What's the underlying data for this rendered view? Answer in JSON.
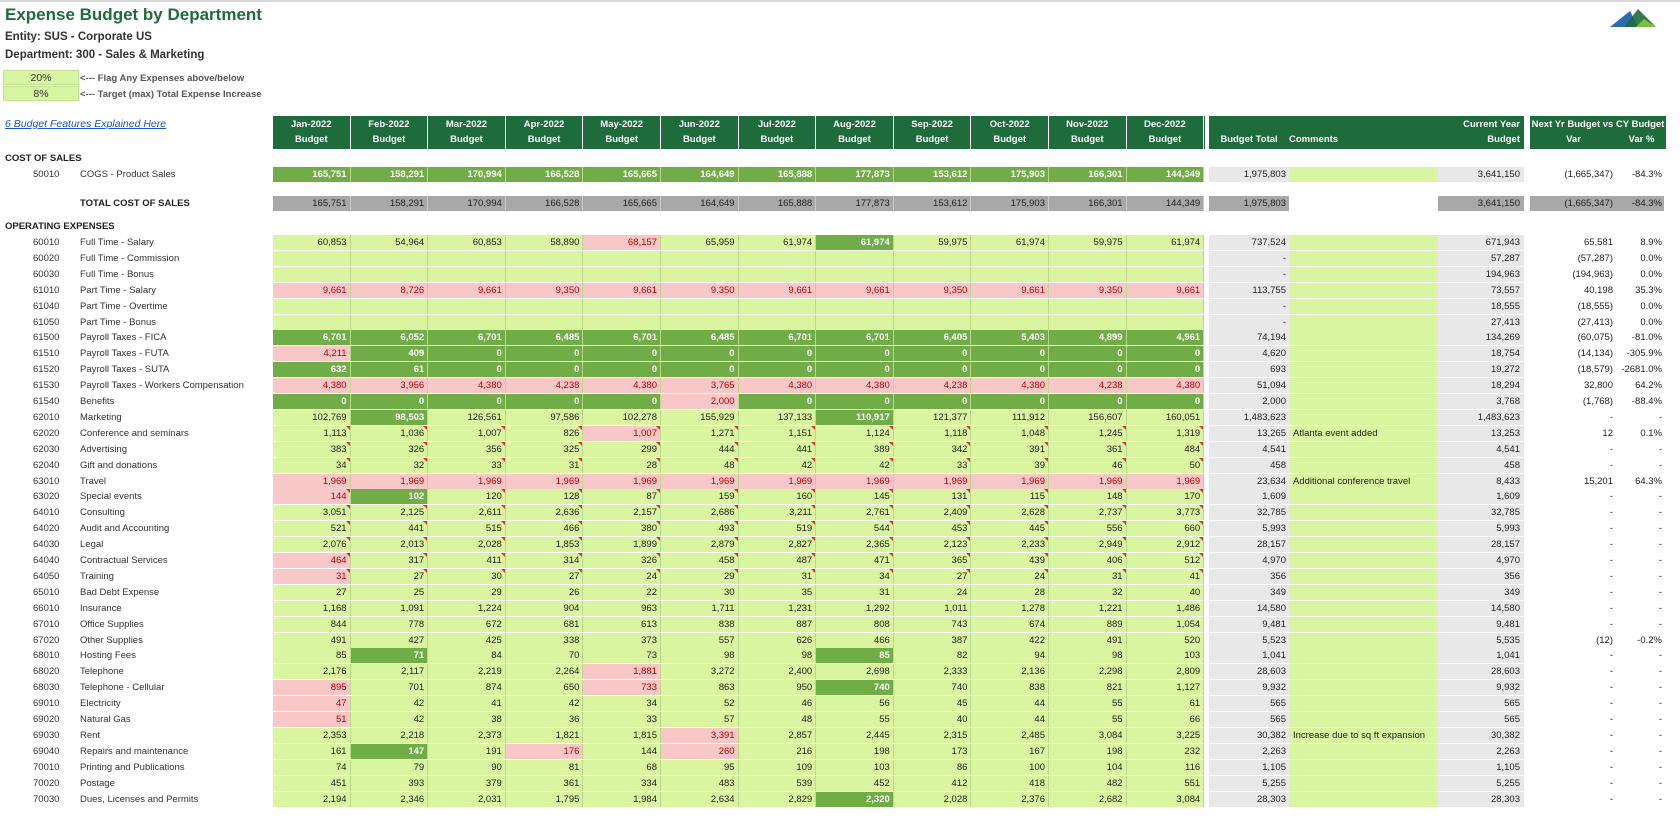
{
  "title": "Expense Budget by Department",
  "entity": "Entity: SUS - Corporate US",
  "department": "Department:  300 - Sales & Marketing",
  "flag_pct": "20%",
  "flag_note": "<--- Flag Any Expenses above/below",
  "target_pct": "8%",
  "target_note": "<--- Target (max) Total Expense Increase",
  "features_link": "6 Budget Features Explained Here",
  "colors": {
    "header_green": "#1e6b3c",
    "input_green": "#d9f5a0",
    "dark_green": "#70ad47",
    "flag_pink": "#f8c8c8",
    "subtotal_gray": "#a8a8a8"
  },
  "months": [
    "Jan-2022",
    "Feb-2022",
    "Mar-2022",
    "Apr-2022",
    "May-2022",
    "Jun-2022",
    "Jul-2022",
    "Aug-2022",
    "Sep-2022",
    "Oct-2022",
    "Nov-2022",
    "Dec-2022"
  ],
  "budget_word": "Budget",
  "hdr_budget_total": "Budget Total",
  "hdr_comments": "Comments",
  "hdr_current_year": "Current Year",
  "hdr_current_budget": "Budget",
  "hdr_next_yr": "Next Yr Budget vs CY Budget",
  "hdr_var": "Var",
  "hdr_var_pct": "Var %",
  "sec_cos": "COST OF SALES",
  "total_cos_label": "TOTAL COST OF SALES",
  "sec_opex": "OPERATING EXPENSES",
  "cos_row": {
    "acct": "50010",
    "name": "COGS - Product Sales",
    "vals": [
      "165,751",
      "158,291",
      "170,994",
      "166,528",
      "165,665",
      "164,649",
      "165,888",
      "177,873",
      "153,612",
      "175,903",
      "166,301",
      "144,349"
    ],
    "total": "1,975,803",
    "comment": "",
    "cy": "3,641,150",
    "var": "(1,665,347)",
    "vp": "-84.3%"
  },
  "total_cos": {
    "vals": [
      "165,751",
      "158,291",
      "170,994",
      "166,528",
      "165,665",
      "164,649",
      "165,888",
      "177,873",
      "153,612",
      "175,903",
      "166,301",
      "144,349"
    ],
    "total": "1,975,803",
    "cy": "3,641,150",
    "var": "(1,665,347)",
    "vp": "-84.3%"
  },
  "rows": [
    {
      "acct": "60010",
      "name": "Full Time - Salary",
      "vals": [
        "60,853",
        "54,964",
        "60,853",
        "58,890",
        "68,157",
        "65,959",
        "61,974",
        "61,974",
        "59,975",
        "61,974",
        "59,975",
        "61,974"
      ],
      "st": "ggggpggdgggg",
      "fl": "",
      "total": "737,524",
      "comment": "",
      "cy": "671,943",
      "var": "65,581",
      "vp": "8.9%"
    },
    {
      "acct": "60020",
      "name": "Full Time - Commission",
      "vals": [
        "",
        "",
        "",
        "",
        "",
        "",
        "",
        "",
        "",
        "",
        "",
        ""
      ],
      "st": "gggggggggggg",
      "fl": "",
      "total": "-",
      "comment": "",
      "cy": "57,287",
      "var": "(57,287)",
      "vp": "0.0%"
    },
    {
      "acct": "60030",
      "name": "Full Time - Bonus",
      "vals": [
        "",
        "",
        "",
        "",
        "",
        "",
        "",
        "",
        "",
        "",
        "",
        ""
      ],
      "st": "gggggggggggg",
      "fl": "",
      "total": "-",
      "comment": "",
      "cy": "194,963",
      "var": "(194,963)",
      "vp": "0.0%"
    },
    {
      "acct": "61010",
      "name": "Part Time - Salary",
      "vals": [
        "9,661",
        "8,726",
        "9,661",
        "9,350",
        "9,661",
        "9,350",
        "9,661",
        "9,661",
        "9,350",
        "9,661",
        "9,350",
        "9,661"
      ],
      "st": "pppppppppppp",
      "fl": "",
      "total": "113,755",
      "comment": "",
      "cy": "73,557",
      "var": "40,198",
      "vp": "35.3%"
    },
    {
      "acct": "61040",
      "name": "Part Time - Overtime",
      "vals": [
        "",
        "",
        "",
        "",
        "",
        "",
        "",
        "",
        "",
        "",
        "",
        ""
      ],
      "st": "gggggggggggg",
      "fl": "",
      "total": "-",
      "comment": "",
      "cy": "18,555",
      "var": "(18,555)",
      "vp": "0.0%"
    },
    {
      "acct": "61050",
      "name": "Part Time - Bonus",
      "vals": [
        "",
        "",
        "",
        "",
        "",
        "",
        "",
        "",
        "",
        "",
        "",
        ""
      ],
      "st": "gggggggggggg",
      "fl": "",
      "total": "-",
      "comment": "",
      "cy": "27,413",
      "var": "(27,413)",
      "vp": "0.0%"
    },
    {
      "acct": "61500",
      "name": "Payroll Taxes - FICA",
      "vals": [
        "6,701",
        "6,052",
        "6,701",
        "6,485",
        "6,701",
        "6,485",
        "6,701",
        "6,701",
        "6,405",
        "5,403",
        "4,899",
        "4,961"
      ],
      "st": "dddddddddddd",
      "fl": "",
      "total": "74,194",
      "comment": "",
      "cy": "134,269",
      "var": "(60,075)",
      "vp": "-81.0%"
    },
    {
      "acct": "61510",
      "name": "Payroll Taxes - FUTA",
      "vals": [
        "4,211",
        "409",
        "0",
        "0",
        "0",
        "0",
        "0",
        "0",
        "0",
        "0",
        "0",
        "0"
      ],
      "st": "pddddddddddd",
      "fl": "",
      "total": "4,620",
      "comment": "",
      "cy": "18,754",
      "var": "(14,134)",
      "vp": "-305.9%"
    },
    {
      "acct": "61520",
      "name": "Payroll Taxes - SUTA",
      "vals": [
        "632",
        "61",
        "0",
        "0",
        "0",
        "0",
        "0",
        "0",
        "0",
        "0",
        "0",
        "0"
      ],
      "st": "dddddddddddd",
      "fl": "",
      "total": "693",
      "comment": "",
      "cy": "19,272",
      "var": "(18,579)",
      "vp": "-2681.0%"
    },
    {
      "acct": "61530",
      "name": "Payroll Taxes - Workers Compensation",
      "vals": [
        "4,380",
        "3,956",
        "4,380",
        "4,238",
        "4,380",
        "3,765",
        "4,380",
        "4,380",
        "4,238",
        "4,380",
        "4,238",
        "4,380"
      ],
      "st": "pppppppppppp",
      "fl": "",
      "total": "51,094",
      "comment": "",
      "cy": "18,294",
      "var": "32,800",
      "vp": "64.2%"
    },
    {
      "acct": "61540",
      "name": "Benefits",
      "vals": [
        "0",
        "0",
        "0",
        "0",
        "0",
        "2,000",
        "0",
        "0",
        "0",
        "0",
        "0",
        "0"
      ],
      "st": "dddddpdddddd",
      "fl": "",
      "total": "2,000",
      "comment": "",
      "cy": "3,768",
      "var": "(1,768)",
      "vp": "-88.4%"
    },
    {
      "acct": "62010",
      "name": "Marketing",
      "vals": [
        "102,769",
        "98,503",
        "126,561",
        "97,586",
        "102,278",
        "155,929",
        "137,133",
        "110,917",
        "121,377",
        "111,912",
        "156,607",
        "160,051"
      ],
      "st": "gdgggggdgggg",
      "fl": "",
      "total": "1,483,623",
      "comment": "",
      "cy": "1,483,623",
      "var": "-",
      "vp": "-"
    },
    {
      "acct": "62020",
      "name": "Conference and seminars",
      "vals": [
        "1,113",
        "1,036",
        "1,007",
        "826",
        "1,007",
        "1,271",
        "1,151",
        "1,124",
        "1,118",
        "1,048",
        "1,245",
        "1,319"
      ],
      "st": "ggggpggggggg",
      "fl": "111111111111",
      "total": "13,265",
      "comment": "Atlanta event added",
      "cy": "13,253",
      "var": "12",
      "vp": "0.1%"
    },
    {
      "acct": "62030",
      "name": "Advertising",
      "vals": [
        "383",
        "326",
        "356",
        "325",
        "299",
        "444",
        "441",
        "389",
        "342",
        "391",
        "361",
        "484"
      ],
      "st": "gggggggggggg",
      "fl": "111111111111",
      "total": "4,541",
      "comment": "",
      "cy": "4,541",
      "var": "-",
      "vp": "-"
    },
    {
      "acct": "62040",
      "name": "Gift and donations",
      "vals": [
        "34",
        "32",
        "33",
        "31",
        "28",
        "48",
        "42",
        "42",
        "33",
        "39",
        "46",
        "50"
      ],
      "st": "gggggggggggg",
      "fl": "111111111111",
      "total": "458",
      "comment": "",
      "cy": "458",
      "var": "-",
      "vp": "-"
    },
    {
      "acct": "63010",
      "name": "Travel",
      "vals": [
        "1,969",
        "1,969",
        "1,969",
        "1,969",
        "1,969",
        "1,969",
        "1,969",
        "1,969",
        "1,969",
        "1,969",
        "1,969",
        "1,969"
      ],
      "st": "pppppppppppp",
      "fl": "",
      "total": "23,634",
      "comment": "Additional conference travel",
      "cy": "8,433",
      "var": "15,201",
      "vp": "64.3%"
    },
    {
      "acct": "63020",
      "name": "Special events",
      "vals": [
        "144",
        "102",
        "120",
        "128",
        "87",
        "159",
        "160",
        "145",
        "131",
        "115",
        "148",
        "170"
      ],
      "st": "pdgggggggggg",
      "fl": "101111111111",
      "total": "1,609",
      "comment": "",
      "cy": "1,609",
      "var": "-",
      "vp": "-"
    },
    {
      "acct": "64010",
      "name": "Consulting",
      "vals": [
        "3,051",
        "2,125",
        "2,611",
        "2,636",
        "2,157",
        "2,686",
        "3,211",
        "2,761",
        "2,409",
        "2,628",
        "2,737",
        "3,773"
      ],
      "st": "gggggggggggg",
      "fl": "111111111111",
      "total": "32,785",
      "comment": "",
      "cy": "32,785",
      "var": "-",
      "vp": "-"
    },
    {
      "acct": "64020",
      "name": "Audit and Accounting",
      "vals": [
        "521",
        "441",
        "515",
        "466",
        "380",
        "493",
        "519",
        "544",
        "453",
        "445",
        "556",
        "660"
      ],
      "st": "gggggggggggg",
      "fl": "111111111111",
      "total": "5,993",
      "comment": "",
      "cy": "5,993",
      "var": "-",
      "vp": "-"
    },
    {
      "acct": "64030",
      "name": "Legal",
      "vals": [
        "2,076",
        "2,013",
        "2,028",
        "1,853",
        "1,899",
        "2,879",
        "2,827",
        "2,365",
        "2,123",
        "2,233",
        "2,949",
        "2,912"
      ],
      "st": "gggggggggggg",
      "fl": "111111111111",
      "total": "28,157",
      "comment": "",
      "cy": "28,157",
      "var": "-",
      "vp": "-"
    },
    {
      "acct": "64040",
      "name": "Contractual Services",
      "vals": [
        "464",
        "317",
        "411",
        "314",
        "326",
        "458",
        "487",
        "471",
        "365",
        "439",
        "406",
        "512"
      ],
      "st": "pggggggggggg",
      "fl": "111111111111",
      "total": "4,970",
      "comment": "",
      "cy": "4,970",
      "var": "-",
      "vp": "-"
    },
    {
      "acct": "64050",
      "name": "Training",
      "vals": [
        "31",
        "27",
        "30",
        "27",
        "24",
        "29",
        "31",
        "34",
        "27",
        "24",
        "31",
        "41"
      ],
      "st": "pggggggggggg",
      "fl": "111111111111",
      "total": "356",
      "comment": "",
      "cy": "356",
      "var": "-",
      "vp": "-"
    },
    {
      "acct": "65010",
      "name": "Bad Debt Expense",
      "vals": [
        "27",
        "25",
        "29",
        "26",
        "22",
        "30",
        "35",
        "31",
        "24",
        "28",
        "32",
        "40"
      ],
      "st": "gggggggggggg",
      "fl": "",
      "total": "349",
      "comment": "",
      "cy": "349",
      "var": "-",
      "vp": "-"
    },
    {
      "acct": "66010",
      "name": "Insurance",
      "vals": [
        "1,168",
        "1,091",
        "1,224",
        "904",
        "963",
        "1,711",
        "1,231",
        "1,292",
        "1,011",
        "1,278",
        "1,221",
        "1,486"
      ],
      "st": "gggggggggggg",
      "fl": "",
      "total": "14,580",
      "comment": "",
      "cy": "14,580",
      "var": "-",
      "vp": "-"
    },
    {
      "acct": "67010",
      "name": "Office Supplies",
      "vals": [
        "844",
        "778",
        "672",
        "681",
        "613",
        "838",
        "887",
        "808",
        "743",
        "674",
        "889",
        "1,054"
      ],
      "st": "gggggggggggg",
      "fl": "",
      "total": "9,481",
      "comment": "",
      "cy": "9,481",
      "var": "-",
      "vp": "-"
    },
    {
      "acct": "67020",
      "name": "Other Supplies",
      "vals": [
        "491",
        "427",
        "425",
        "338",
        "373",
        "557",
        "626",
        "466",
        "387",
        "422",
        "491",
        "520"
      ],
      "st": "gggggggggggg",
      "fl": "",
      "total": "5,523",
      "comment": "",
      "cy": "5,535",
      "var": "(12)",
      "vp": "-0.2%"
    },
    {
      "acct": "68010",
      "name": "Hosting Fees",
      "vals": [
        "85",
        "71",
        "84",
        "70",
        "73",
        "98",
        "98",
        "85",
        "82",
        "94",
        "98",
        "103"
      ],
      "st": "gdgggggdgggg",
      "fl": "",
      "total": "1,041",
      "comment": "",
      "cy": "1,041",
      "var": "-",
      "vp": "-"
    },
    {
      "acct": "68020",
      "name": "Telephone",
      "vals": [
        "2,176",
        "2,117",
        "2,219",
        "2,264",
        "1,881",
        "3,272",
        "2,400",
        "2,698",
        "2,333",
        "2,136",
        "2,298",
        "2,809"
      ],
      "st": "ggggpggggggg",
      "fl": "",
      "total": "28,603",
      "comment": "",
      "cy": "28,603",
      "var": "-",
      "vp": "-"
    },
    {
      "acct": "68030",
      "name": "Telephone - Cellular",
      "vals": [
        "895",
        "701",
        "874",
        "650",
        "733",
        "863",
        "950",
        "740",
        "740",
        "838",
        "821",
        "1,127"
      ],
      "st": "pgggpggdgggg",
      "fl": "",
      "total": "9,932",
      "comment": "",
      "cy": "9,932",
      "var": "-",
      "vp": "-"
    },
    {
      "acct": "69010",
      "name": "Electricity",
      "vals": [
        "47",
        "42",
        "41",
        "42",
        "34",
        "52",
        "46",
        "56",
        "45",
        "44",
        "55",
        "61"
      ],
      "st": "pggggggggggg",
      "fl": "",
      "total": "565",
      "comment": "",
      "cy": "565",
      "var": "-",
      "vp": "-"
    },
    {
      "acct": "69020",
      "name": "Natural Gas",
      "vals": [
        "51",
        "42",
        "38",
        "36",
        "33",
        "57",
        "48",
        "55",
        "40",
        "44",
        "55",
        "66"
      ],
      "st": "pggggggggggg",
      "fl": "",
      "total": "565",
      "comment": "",
      "cy": "565",
      "var": "-",
      "vp": "-"
    },
    {
      "acct": "69030",
      "name": "Rent",
      "vals": [
        "2,353",
        "2,218",
        "2,373",
        "1,821",
        "1,815",
        "3,391",
        "2,857",
        "2,445",
        "2,315",
        "2,485",
        "3,084",
        "3,225"
      ],
      "st": "gggggpgggggg",
      "fl": "",
      "total": "30,382",
      "comment": "Increase due to sq ft expansion",
      "cy": "30,382",
      "var": "-",
      "vp": "-"
    },
    {
      "acct": "69040",
      "name": "Repairs and maintenance",
      "vals": [
        "161",
        "147",
        "191",
        "176",
        "144",
        "260",
        "216",
        "198",
        "173",
        "167",
        "198",
        "232"
      ],
      "st": "gdgpgpgggggg",
      "fl": "",
      "total": "2,263",
      "comment": "",
      "cy": "2,263",
      "var": "-",
      "vp": "-"
    },
    {
      "acct": "70010",
      "name": "Printing and Publications",
      "vals": [
        "74",
        "79",
        "90",
        "81",
        "68",
        "95",
        "109",
        "103",
        "86",
        "100",
        "104",
        "116"
      ],
      "st": "gggggggggggg",
      "fl": "",
      "total": "1,105",
      "comment": "",
      "cy": "1,105",
      "var": "-",
      "vp": "-"
    },
    {
      "acct": "70020",
      "name": "Postage",
      "vals": [
        "451",
        "393",
        "379",
        "361",
        "334",
        "483",
        "539",
        "452",
        "412",
        "418",
        "482",
        "551"
      ],
      "st": "gggggggggggg",
      "fl": "",
      "total": "5,255",
      "comment": "",
      "cy": "5,255",
      "var": "-",
      "vp": "-"
    },
    {
      "acct": "70030",
      "name": "Dues, Licenses and Permits",
      "vals": [
        "2,194",
        "2,346",
        "2,031",
        "1,795",
        "1,984",
        "2,634",
        "2,829",
        "2,320",
        "2,028",
        "2,376",
        "2,682",
        "3,084"
      ],
      "st": "gggggggdgggg",
      "fl": "",
      "total": "28,303",
      "comment": "",
      "cy": "28,303",
      "var": "-",
      "vp": "-"
    }
  ]
}
